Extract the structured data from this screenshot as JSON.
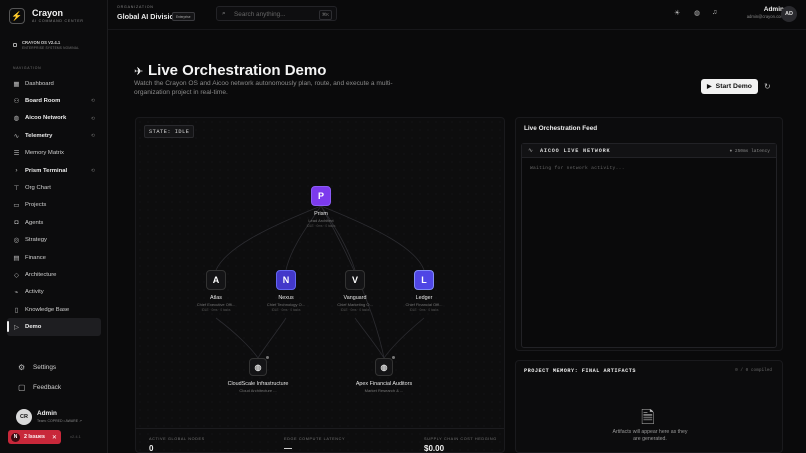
{
  "brand": {
    "name": "Crayon",
    "sub": "AI COMMAND CENTER",
    "logo_icon": "bolt-icon"
  },
  "version": {
    "line1": "CRAYON OS V2.4.1",
    "line2": "ENTERPRISE SYSTEMS NOMINAL"
  },
  "sidebar": {
    "heading": "NAVIGATION",
    "items": [
      {
        "label": "Dashboard",
        "icon": "grid-icon"
      },
      {
        "label": "Board Room",
        "icon": "users-icon"
      },
      {
        "label": "Aicoo Network",
        "icon": "globe-icon"
      },
      {
        "label": "Telemetry",
        "icon": "activity-icon"
      },
      {
        "label": "Memory Matrix",
        "icon": "database-icon"
      },
      {
        "label": "Prism Terminal",
        "icon": "terminal-icon"
      },
      {
        "label": "Org Chart",
        "icon": "org-icon"
      },
      {
        "label": "Projects",
        "icon": "folder-icon"
      },
      {
        "label": "Agents",
        "icon": "bot-icon"
      },
      {
        "label": "Strategy",
        "icon": "target-icon"
      },
      {
        "label": "Finance",
        "icon": "wallet-icon"
      },
      {
        "label": "Architecture",
        "icon": "layers-icon"
      },
      {
        "label": "Activity",
        "icon": "pulse-icon"
      },
      {
        "label": "Knowledge Base",
        "icon": "book-icon"
      },
      {
        "label": "Demo",
        "icon": "play-icon"
      }
    ],
    "settings": "Settings",
    "feedback": "Feedback"
  },
  "user": {
    "initials": "CR",
    "name": "Admin",
    "meta": "Team: COPRED • AWARE ↗"
  },
  "issues": {
    "count": "N",
    "label": "2 Issues",
    "close": "✕"
  },
  "build": "v2.4.1",
  "topbar": {
    "org_label": "ORGANIZATION",
    "org_name": "Global AI Division",
    "org_badge": "Enterprise",
    "search_placeholder": "Search anything...",
    "search_kbd": "⌘K",
    "user_name": "Admin",
    "user_email": "admin@crayon.com",
    "user_initials": "AD"
  },
  "page": {
    "title": "Live Orchestration Demo",
    "subtitle": "Watch the Crayon OS and Aicoo network autonomously plan, route, and execute a multi-organization project in real-time.",
    "start_label": "Start Demo"
  },
  "canvas": {
    "state": "STATE: IDLE",
    "nodes": [
      {
        "letter": "P",
        "name": "Prism",
        "role": "Lead Architect",
        "meta": "IDLE · 0ms · 0 tasks",
        "color": "#7c3aed"
      },
      {
        "letter": "A",
        "name": "Atlas",
        "role": "Chief Executive Offi...",
        "meta": "IDLE · 0ms · 0 tasks",
        "color": "#141416"
      },
      {
        "letter": "N",
        "name": "Nexus",
        "role": "Chief Technology O...",
        "meta": "IDLE · 0ms · 0 tasks",
        "color": "#4338ca"
      },
      {
        "letter": "V",
        "name": "Vanguard",
        "role": "Chief Marketing O...",
        "meta": "IDLE · 0ms · 0 tasks",
        "color": "#141416"
      },
      {
        "letter": "L",
        "name": "Ledger",
        "role": "Chief Financial Offi...",
        "meta": "IDLE · 0ms · 0 tasks",
        "color": "#4f46e5"
      }
    ],
    "external": [
      {
        "name": "CloudScale Infrastructure",
        "role": "Cloud Architecture ..."
      },
      {
        "name": "Apex Financial Auditors",
        "role": "Market Research & ..."
      }
    ],
    "stats": [
      {
        "label": "ACTIVE GLOBAL NODES",
        "value": "0"
      },
      {
        "label": "EDGE COMPUTE LATENCY",
        "value": "—"
      },
      {
        "label": "SUPPLY CHAIN COST HEDGING",
        "value": "$0.00"
      }
    ]
  },
  "feed": {
    "title": "Live Orchestration Feed",
    "terminal_title": "AICOO LIVE NETWORK",
    "latency": "● 250ms latency",
    "waiting": "Waiting for network activity..."
  },
  "memory": {
    "title": "PROJECT MEMORY: FINAL ARTIFACTS",
    "count": "0 / 0 compiled",
    "empty": "Artifacts will appear here as they are generated."
  }
}
